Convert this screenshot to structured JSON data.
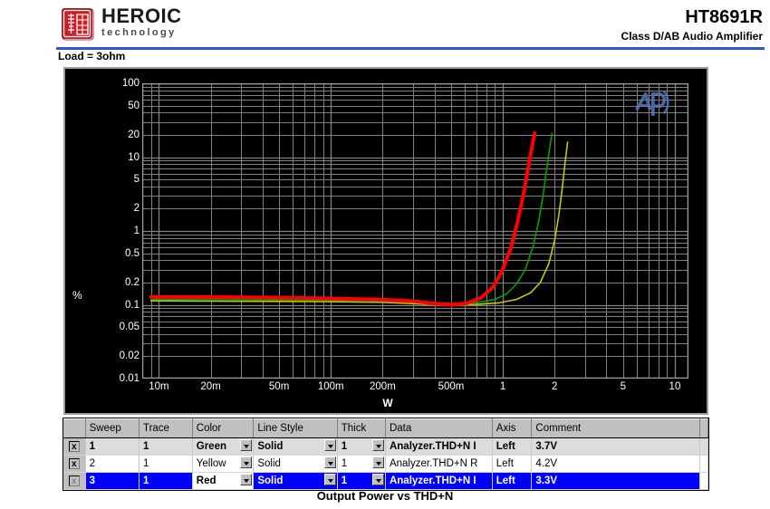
{
  "header": {
    "logo_primary": "HEROIC",
    "logo_secondary": "technology",
    "logo_icon": "heroic-seal-icon",
    "part_number": "HT8691R",
    "part_description": "Class D/AB Audio Amplifier",
    "accent_color": "#3355cc"
  },
  "chart_conditions": {
    "load_label": "Load = 3ohm"
  },
  "caption": "Output Power vs THD+N",
  "plot": {
    "watermark": "AP",
    "watermark_name": "audio-precision-logo"
  },
  "chart_data": {
    "type": "line",
    "title": "Output Power vs THD+N",
    "xlabel": "W",
    "ylabel": "%",
    "xscale": "log",
    "yscale": "log",
    "xlim": [
      0.008,
      12
    ],
    "ylim": [
      0.01,
      100
    ],
    "grid": true,
    "legend": "table",
    "xticks": [
      "10m",
      "20m",
      "50m",
      "100m",
      "200m",
      "500m",
      "1",
      "2",
      "5",
      "10"
    ],
    "xtick_values": [
      0.01,
      0.02,
      0.05,
      0.1,
      0.2,
      0.5,
      1,
      2,
      5,
      10
    ],
    "yticks": [
      "100",
      "50",
      "20",
      "10",
      "5",
      "2",
      "1",
      "0.5",
      "0.2",
      "0.1",
      "0.05",
      "0.02",
      "0.01"
    ],
    "ytick_values": [
      100,
      50,
      20,
      10,
      5,
      2,
      1,
      0.5,
      0.2,
      0.1,
      0.05,
      0.02,
      0.01
    ],
    "series": [
      {
        "name": "Sweep 1 - 3.7V",
        "color": "#00a000",
        "comment": "3.7V",
        "x": [
          0.009,
          0.02,
          0.05,
          0.1,
          0.2,
          0.35,
          0.5,
          0.7,
          0.9,
          1.05,
          1.2,
          1.35,
          1.5,
          1.62,
          1.72,
          1.8,
          1.87,
          1.93
        ],
        "y": [
          0.118,
          0.117,
          0.116,
          0.115,
          0.112,
          0.106,
          0.104,
          0.107,
          0.118,
          0.14,
          0.19,
          0.3,
          0.62,
          1.4,
          3.2,
          7.0,
          13.0,
          21.0
        ]
      },
      {
        "name": "Sweep 2 - 4.2V",
        "color": "#c8c800",
        "comment": "4.2V",
        "x": [
          0.009,
          0.02,
          0.05,
          0.1,
          0.2,
          0.35,
          0.5,
          0.7,
          0.95,
          1.2,
          1.45,
          1.65,
          1.85,
          2.0,
          2.12,
          2.22,
          2.3,
          2.38
        ],
        "y": [
          0.113,
          0.112,
          0.111,
          0.11,
          0.108,
          0.102,
          0.1,
          0.101,
          0.106,
          0.118,
          0.145,
          0.2,
          0.36,
          0.75,
          1.7,
          4.0,
          8.5,
          16.0
        ]
      },
      {
        "name": "Sweep 3 - 3.3V",
        "color": "#ff0000",
        "comment": "3.3V",
        "x": [
          0.009,
          0.02,
          0.05,
          0.1,
          0.2,
          0.3,
          0.4,
          0.5,
          0.62,
          0.75,
          0.88,
          1.0,
          1.12,
          1.22,
          1.32,
          1.4,
          1.47,
          1.53
        ],
        "y": [
          0.128,
          0.127,
          0.125,
          0.122,
          0.117,
          0.112,
          0.104,
          0.1,
          0.105,
          0.125,
          0.175,
          0.3,
          0.62,
          1.35,
          3.2,
          7.0,
          13.0,
          21.0
        ]
      }
    ]
  },
  "table": {
    "columns": [
      "",
      "Sweep",
      "Trace",
      "Color",
      "Line Style",
      "Thick",
      "Data",
      "Axis",
      "Comment",
      ""
    ],
    "rows": [
      {
        "enable": "x",
        "sweep": "1",
        "trace": "1",
        "color": "Green",
        "line_style": "Solid",
        "thick": "1",
        "data": "Analyzer.THD+N I",
        "axis": "Left",
        "comment": "3.7V"
      },
      {
        "enable": "x",
        "sweep": "2",
        "trace": "1",
        "color": "Yellow",
        "line_style": "Solid",
        "thick": "1",
        "data": "Analyzer.THD+N R",
        "axis": "Left",
        "comment": "4.2V"
      },
      {
        "enable": "x",
        "sweep": "3",
        "trace": "1",
        "color": "Red",
        "line_style": "Solid",
        "thick": "1",
        "data": "Analyzer.THD+N I",
        "axis": "Left",
        "comment": "3.3V"
      }
    ]
  }
}
